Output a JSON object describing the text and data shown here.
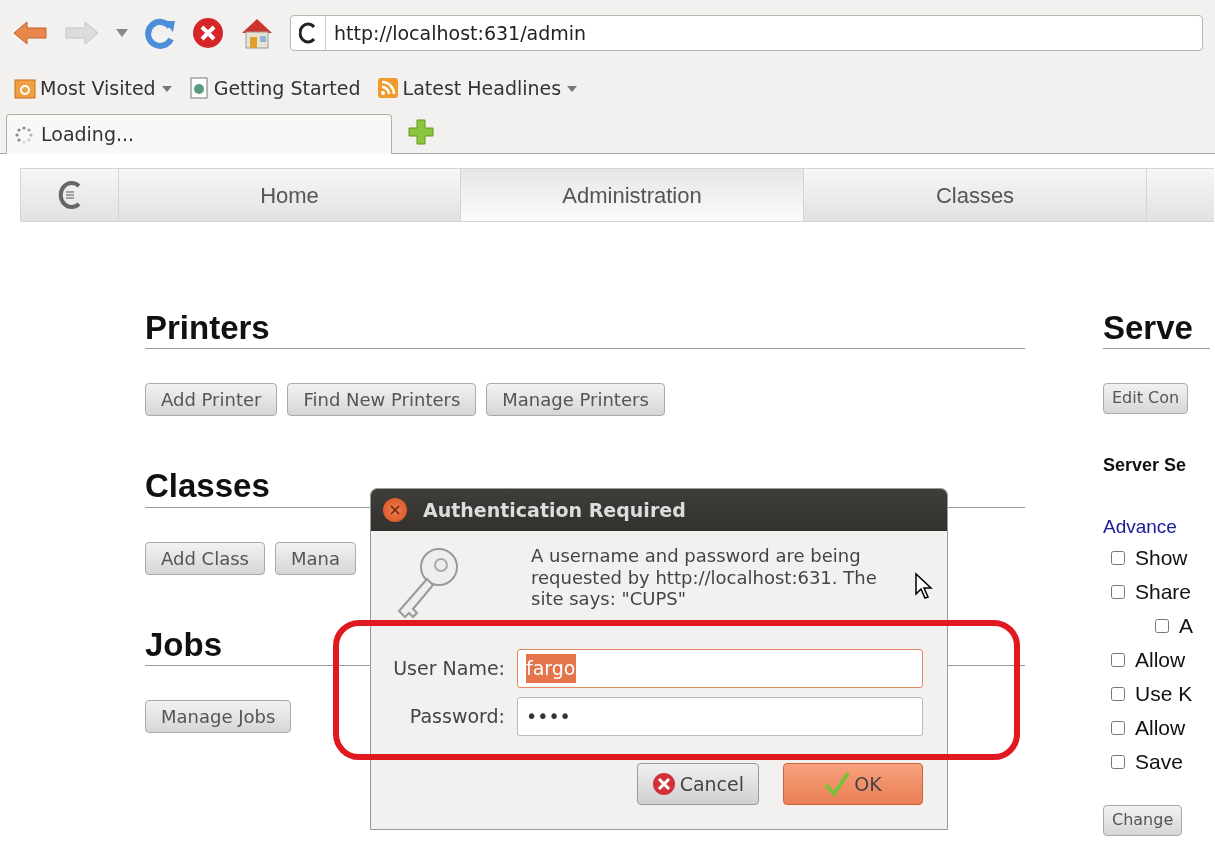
{
  "browser": {
    "url": "http://localhost:631/admin",
    "bookmarks": [
      {
        "label": "Most Visited",
        "kind": "folder",
        "has_menu": true
      },
      {
        "label": "Getting Started",
        "kind": "page",
        "has_menu": false
      },
      {
        "label": "Latest Headlines",
        "kind": "feed",
        "has_menu": true
      }
    ],
    "tabs": [
      {
        "label": "Loading...",
        "loading": true
      }
    ]
  },
  "site_nav": [
    {
      "kind": "logo",
      "selected": false
    },
    {
      "kind": "tab",
      "label": "Home",
      "selected": false
    },
    {
      "kind": "tab",
      "label": "Administration",
      "selected": true
    },
    {
      "kind": "tab",
      "label": "Classes",
      "selected": false
    },
    {
      "kind": "tab",
      "selected": false
    }
  ],
  "sections": [
    {
      "title": "Printers",
      "buttons": [
        "Add Printer",
        "Find New Printers",
        "Manage Printers"
      ]
    },
    {
      "title": "Classes",
      "buttons": [
        "Add Class",
        "Mana"
      ]
    },
    {
      "title": "Jobs",
      "buttons": [
        "Manage Jobs"
      ]
    }
  ],
  "server": {
    "title": "Serve",
    "buttons": [
      "Edit Con"
    ],
    "subheading": "Server Se",
    "link": "Advance",
    "checkboxes": [
      {
        "label": "Show",
        "checked": false
      },
      {
        "label": "Share",
        "checked": false,
        "children": [
          {
            "label": "A",
            "checked": false
          }
        ]
      },
      {
        "label": "Allow",
        "checked": false
      },
      {
        "label": "Use K",
        "checked": false
      },
      {
        "label": "Allow",
        "checked": false
      },
      {
        "label": "Save",
        "checked": false
      }
    ],
    "submit": "Change"
  },
  "dialog": {
    "title": "Authentication Required",
    "message": "A username and password are being requested by http://localhost:631. The site says: \"CUPS\"",
    "fields": [
      {
        "label": "User Name:",
        "value": "fargo",
        "focused": true,
        "text_selected": true
      },
      {
        "label": "Password:",
        "value": "••••",
        "focused": false,
        "text_selected": false
      }
    ],
    "buttons": [
      {
        "label": "Cancel",
        "kind": "cancel",
        "default": false
      },
      {
        "label": "OK",
        "kind": "ok",
        "default": true
      }
    ]
  }
}
